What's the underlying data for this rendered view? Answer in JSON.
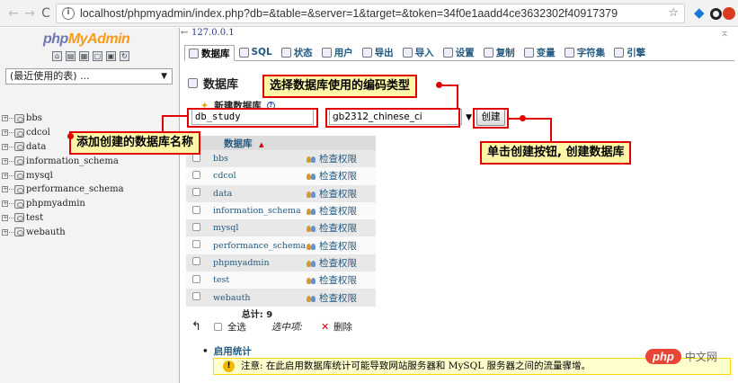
{
  "browser": {
    "url": "localhost/phpmyadmin/index.php?db=&table=&server=1&target=&token=34f0e1aadd4ce3632302f40917379"
  },
  "sidebar": {
    "logo_part1": "php",
    "logo_part2": "MyAdmin",
    "recent_label": "(最近使用的表) ...",
    "databases": [
      "bbs",
      "cdcol",
      "data",
      "information_schema",
      "mysql",
      "performance_schema",
      "phpmyadmin",
      "test",
      "webauth"
    ]
  },
  "header": {
    "server": "127.0.0.1",
    "tabs": [
      {
        "label": "数据库",
        "active": true
      },
      {
        "label": "SQL"
      },
      {
        "label": "状态"
      },
      {
        "label": "用户"
      },
      {
        "label": "导出"
      },
      {
        "label": "导入"
      },
      {
        "label": "设置"
      },
      {
        "label": "复制"
      },
      {
        "label": "变量"
      },
      {
        "label": "字符集"
      },
      {
        "label": "引擎"
      }
    ]
  },
  "main": {
    "title": "数据库",
    "create_db_label": "新建数据库",
    "dbname_value": "db_study",
    "collation_value": "gb2312_chinese_ci",
    "create_button": "创建",
    "table_header": "数据库",
    "sort_indicator": "▲",
    "privilege_label": "检查权限",
    "total_label": "总计: 9",
    "select_all": "全选",
    "with_selected": "选中项:",
    "delete_label": "删除",
    "enable_stats": "启用统计",
    "notice": "注意: 在此启用数据库统计可能导致网站服务器和 MySQL 服务器之间的流量骤增。"
  },
  "annotations": {
    "encoding": "选择数据库使用的编码类型",
    "dbname": "添加创建的数据库名称",
    "create": "单击创建按钮, 创建数据库"
  },
  "watermark": {
    "logo": "php",
    "text": "中文网"
  },
  "colors": {
    "accent": "#e10000",
    "link": "#235a81",
    "callout_bg": "#fff7a8"
  }
}
